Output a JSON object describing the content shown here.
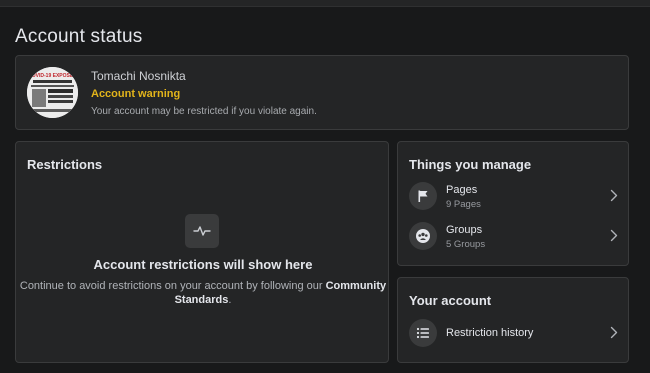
{
  "page": {
    "title": "Account status"
  },
  "status": {
    "user_name": "Tomachi Nosnikta",
    "warning_label": "Account warning",
    "warning_description": "Your account may be restricted if you violate again.",
    "avatar_text": "COVID-19 EXPOSED",
    "warning_color": "#e2b41b"
  },
  "restrictions": {
    "title": "Restrictions",
    "icon": "activity-icon",
    "empty_title": "Account restrictions will show here",
    "empty_desc_prefix": "Continue to avoid restrictions on your account by following our ",
    "empty_desc_link": "Community Standards",
    "empty_desc_suffix": "."
  },
  "manage": {
    "title": "Things you manage",
    "items": [
      {
        "label": "Pages",
        "sub": "9 Pages",
        "icon": "flag-icon"
      },
      {
        "label": "Groups",
        "sub": "5 Groups",
        "icon": "groups-icon"
      }
    ]
  },
  "account": {
    "title": "Your account",
    "items": [
      {
        "label": "Restriction history",
        "icon": "list-icon"
      }
    ]
  },
  "colors": {
    "background": "#18191a",
    "card": "#242526",
    "border": "#3a3b3c"
  }
}
